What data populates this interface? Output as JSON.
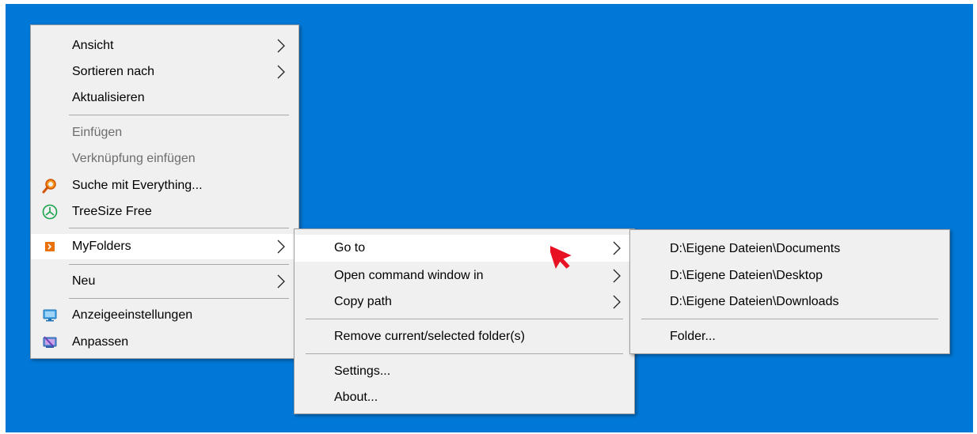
{
  "desktop_menu": {
    "items": [
      {
        "label": "Ansicht"
      },
      {
        "label": "Sortieren nach"
      },
      {
        "label": "Aktualisieren"
      },
      {
        "label": "Einfügen"
      },
      {
        "label": "Verknüpfung einfügen"
      },
      {
        "label": "Suche mit Everything..."
      },
      {
        "label": "TreeSize Free"
      },
      {
        "label": "MyFolders"
      },
      {
        "label": "Neu"
      },
      {
        "label": "Anzeigeeinstellungen"
      },
      {
        "label": "Anpassen"
      }
    ]
  },
  "myfolders_menu": {
    "items": [
      {
        "label": "Go to"
      },
      {
        "label": "Open command window in"
      },
      {
        "label": "Copy path"
      },
      {
        "label": "Remove current/selected folder(s)"
      },
      {
        "label": "Settings..."
      },
      {
        "label": "About..."
      }
    ]
  },
  "goto_menu": {
    "items": [
      {
        "label": "D:\\Eigene Dateien\\Documents"
      },
      {
        "label": "D:\\Eigene Dateien\\Desktop"
      },
      {
        "label": "D:\\Eigene Dateien\\Downloads"
      },
      {
        "label": "Folder..."
      }
    ]
  },
  "colors": {
    "desktop": "#0078d7",
    "menu_bg": "#f0f0f0",
    "disabled_text": "#6d6d6d",
    "cursor": "#e81123"
  }
}
